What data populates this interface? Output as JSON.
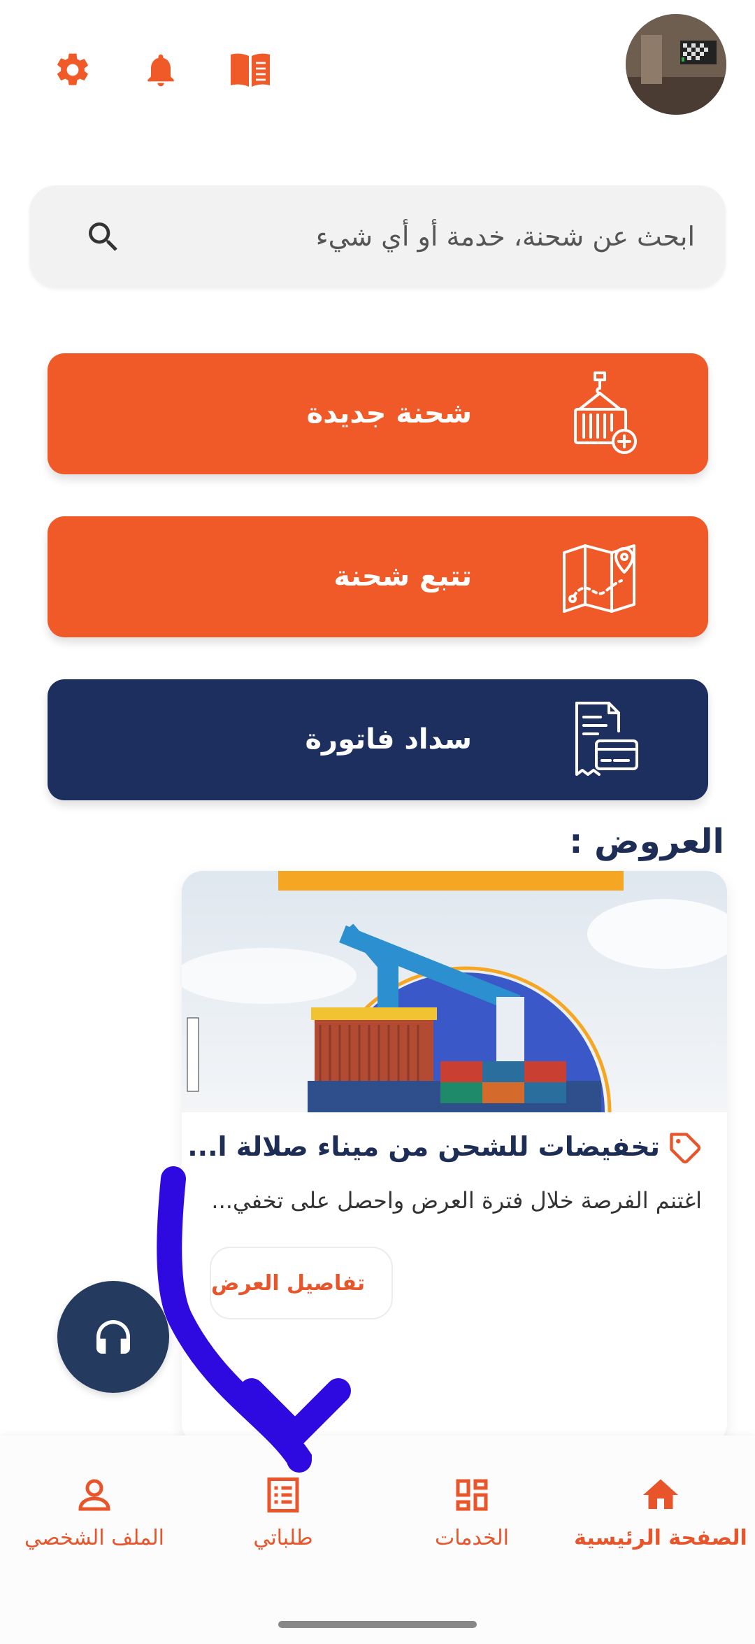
{
  "header": {
    "icons": [
      "gear-icon",
      "bell-icon",
      "book-icon"
    ],
    "avatar": "avatar"
  },
  "search": {
    "placeholder": "ابحث عن شحنة، خدمة أو أي شيء"
  },
  "actions": [
    {
      "label": "شحنة جديدة",
      "icon": "container-crane-icon",
      "color": "#f05a28"
    },
    {
      "label": "تتبع شحنة",
      "icon": "map-pin-icon",
      "color": "#f05a28"
    },
    {
      "label": "سداد فاتورة",
      "icon": "invoice-card-icon",
      "color": "#1d2f5e"
    }
  ],
  "offers": {
    "title": "العروض :",
    "card": {
      "title": "تخفيضات للشحن من ميناء صلالة ا...",
      "description": "اغتنم الفرصة خلال فترة العرض واحصل على تخفي...",
      "button": "تفاصيل العرض"
    }
  },
  "nav": {
    "items": [
      {
        "label": "الصفحة الرئيسية",
        "icon": "home-icon",
        "active": true
      },
      {
        "label": "الخدمات",
        "icon": "grid-icon",
        "active": false
      },
      {
        "label": "طلباتي",
        "icon": "list-icon",
        "active": false
      },
      {
        "label": "الملف الشخصي",
        "icon": "person-icon",
        "active": false
      }
    ]
  },
  "colors": {
    "accent": "#f05a28",
    "navy": "#1d2f5e",
    "support": "#243a5e",
    "gesture": "#2e0ae0"
  }
}
